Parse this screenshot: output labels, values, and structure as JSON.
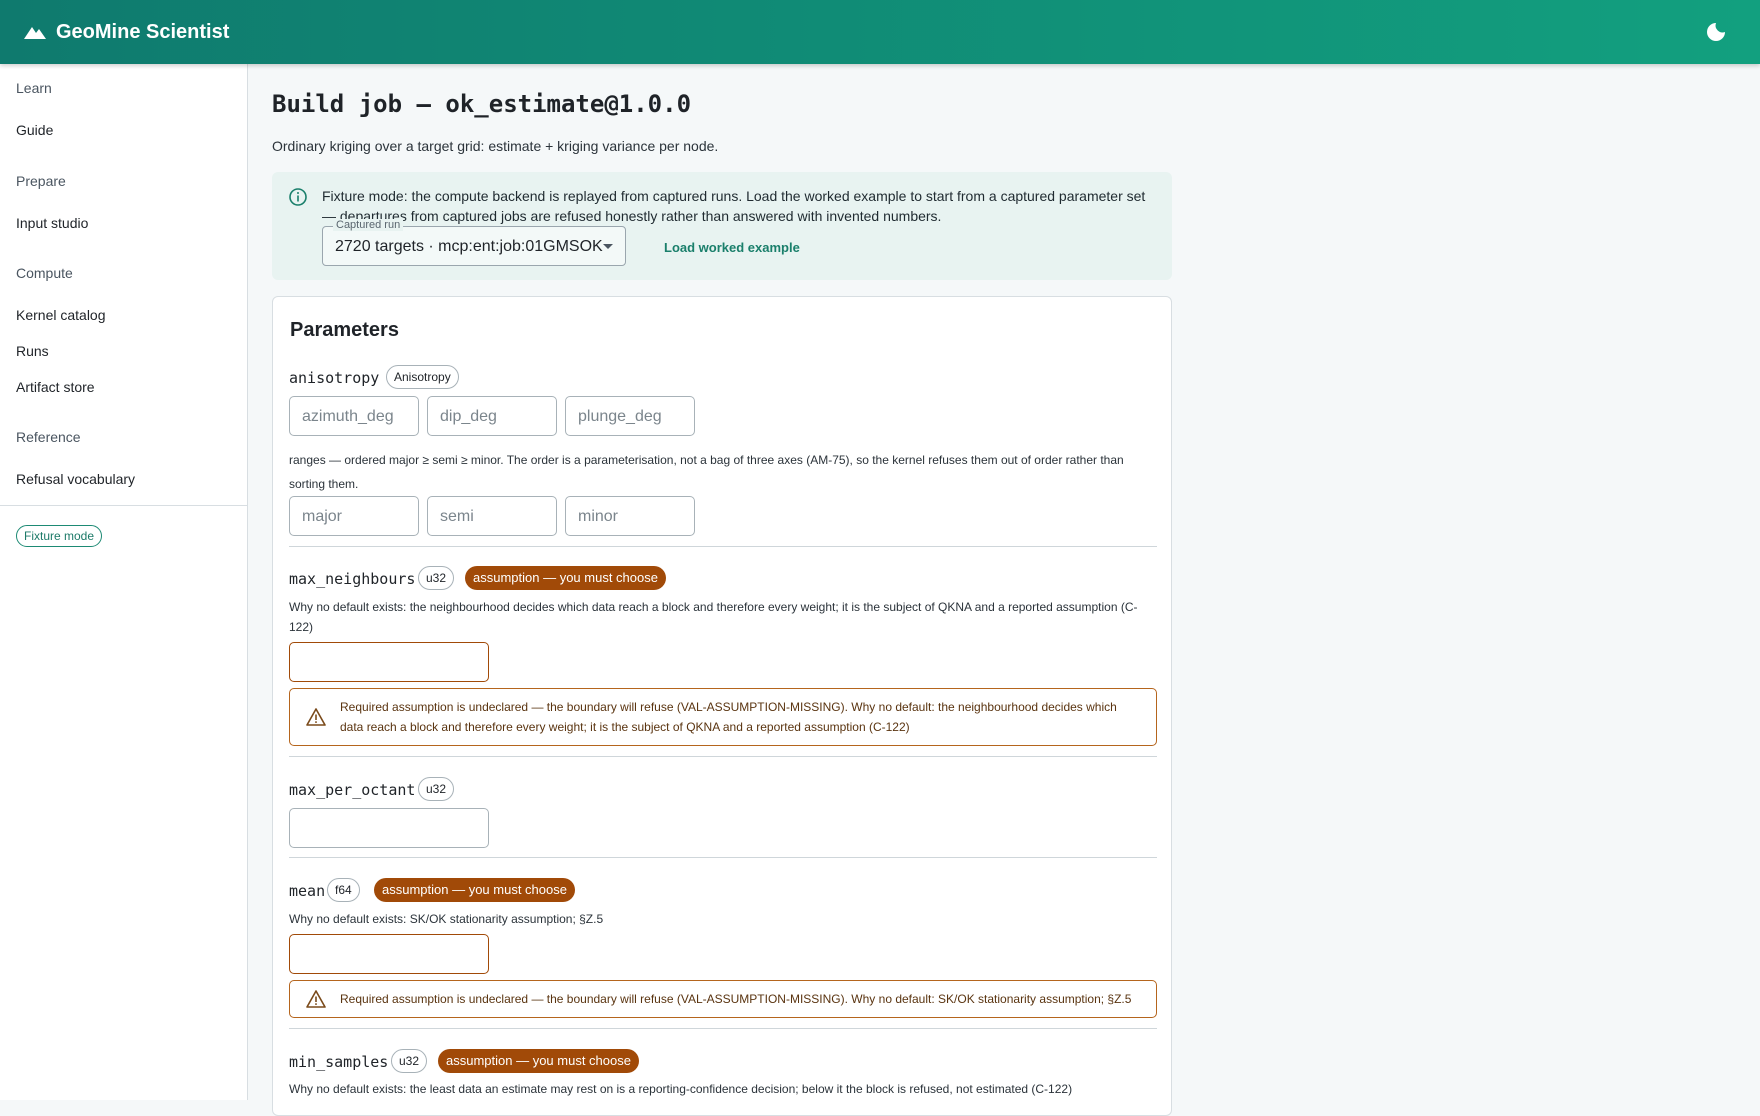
{
  "app": {
    "title": "GeoMine Scientist"
  },
  "sidebar": {
    "groups": [
      {
        "label": "Learn"
      },
      {
        "label": "Prepare"
      },
      {
        "label": "Compute"
      },
      {
        "label": "Reference"
      }
    ],
    "items": {
      "guide": "Guide",
      "input_studio": "Input studio",
      "kernel_catalog": "Kernel catalog",
      "runs": "Runs",
      "artifact_store": "Artifact store",
      "refusal_vocabulary": "Refusal vocabulary"
    },
    "fixture_chip": "Fixture mode"
  },
  "page": {
    "title": "Build job — ok_estimate@1.0.0",
    "subtitle": "Ordinary kriging over a target grid: estimate + kriging variance per node."
  },
  "alert": {
    "text": "Fixture mode: the compute backend is replayed from captured runs. Load the worked example to start from a captured parameter set — departures from captured jobs are refused honestly rather than answered with invented numbers.",
    "select_label": "Captured run",
    "select_value": "2720 targets · mcp:ent:job:01GMSOK",
    "load_link": "Load worked example"
  },
  "parameters": {
    "heading": "Parameters",
    "anisotropy": {
      "name": "anisotropy",
      "type": "Anisotropy",
      "fields": {
        "azimuth": "azimuth_deg",
        "dip": "dip_deg",
        "plunge": "plunge_deg"
      },
      "ranges_help": "ranges — ordered major ≥ semi ≥ minor. The order is a parameterisation, not a bag of three axes (AM-75), so the kernel refuses them out of order rather than sorting them.",
      "range_fields": {
        "major": "major",
        "semi": "semi",
        "minor": "minor"
      }
    },
    "max_neighbours": {
      "name": "max_neighbours",
      "type": "u32",
      "badge": "assumption — you must choose",
      "help": "Why no default exists: the neighbourhood decides which data reach a block and therefore every weight; it is the subject of QKNA and a reported assumption (C-122)",
      "warning": "Required assumption is undeclared — the boundary will refuse (VAL-ASSUMPTION-MISSING). Why no default: the neighbourhood decides which data reach a block and therefore every weight; it is the subject of QKNA and a reported assumption (C-122)"
    },
    "max_per_octant": {
      "name": "max_per_octant",
      "type": "u32"
    },
    "mean": {
      "name": "mean",
      "type": "f64",
      "badge": "assumption — you must choose",
      "help": "Why no default exists: SK/OK stationarity assumption; §Z.5",
      "warning": "Required assumption is undeclared — the boundary will refuse (VAL-ASSUMPTION-MISSING). Why no default: SK/OK stationarity assumption; §Z.5"
    },
    "min_samples": {
      "name": "min_samples",
      "type": "u32",
      "badge": "assumption — you must choose",
      "help": "Why no default exists: the least data an estimate may rest on is a reporting-confidence decision; below it the block is refused, not estimated (C-122)"
    }
  },
  "colors": {
    "accent": "#12a07f",
    "warn": "#a14a08",
    "link": "#1a7f6b"
  }
}
